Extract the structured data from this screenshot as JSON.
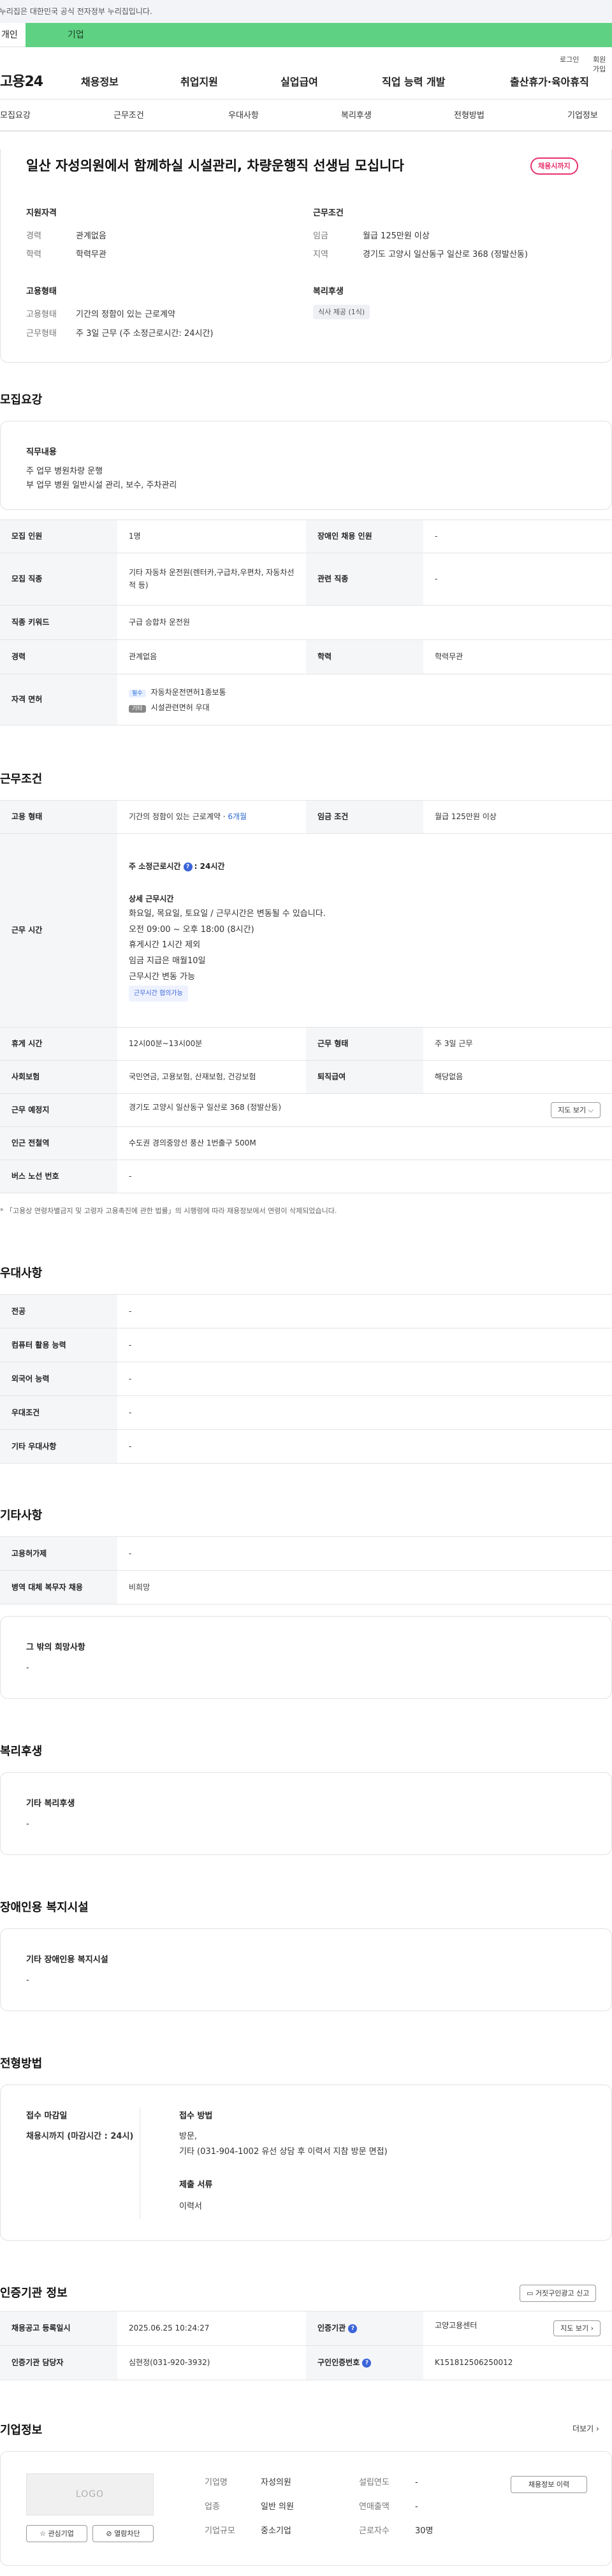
{
  "notice": "이 누리집은 대한민국 공식 전자정부 누리집입니다.",
  "switcher": {
    "personal": "개인",
    "business": "기업"
  },
  "util": {
    "login": "로그인",
    "join": "회원가입"
  },
  "gnb": {
    "logo": "고용24",
    "menus": [
      "채용정보",
      "취업지원",
      "실업급여",
      "직업 능력 개발",
      "출산휴가·육아휴직"
    ]
  },
  "tabs": [
    "모집요강",
    "근무조건",
    "우대사항",
    "복리후생",
    "전형방법",
    "기업정보"
  ],
  "hero": {
    "title": "일산 자성의원에서 함께하실 시설관리, 차량운행직 선생님 모십니다",
    "badge": "채용시까지",
    "qual_title": "지원자격",
    "qual": [
      {
        "k": "경력",
        "v": "관계없음"
      },
      {
        "k": "학력",
        "v": "학력무관"
      }
    ],
    "work_title": "근무조건",
    "work": [
      {
        "k": "임금",
        "v": "월급 125만원 이상"
      },
      {
        "k": "지역",
        "v": "경기도 고양시 일산동구 일산로 368 (정발산동)"
      }
    ],
    "emp_title": "고용형태",
    "emp": [
      {
        "k": "고용형태",
        "v": "기간의 정함이 있는 근로계약"
      },
      {
        "k": "근무형태",
        "v": "주 3일 근무 (주 소정근로시간: 24시간)"
      }
    ],
    "welfare_title": "복리후생",
    "welfare_pill": "식사 제공 (1식)"
  },
  "recruit": {
    "heading": "모집요강",
    "duty_title": "직무내용",
    "duty_lines": [
      "주 업무 병원차량 운행",
      "부 업무 병원 일반시설 관리, 보수, 주차관리"
    ],
    "rows": {
      "count_k": "모집 인원",
      "count_v": "1명",
      "disabled_k": "장애인 채용 인원",
      "disabled_v": "-",
      "job_k": "모집 직종",
      "job_v": "기타 자동차 운전원(렌터카,구급차,우편차, 자동차선적 등)",
      "related_k": "관련 직종",
      "related_v": "-",
      "kw_k": "직종 키워드",
      "kw_v": "구급 승합차 운전원",
      "career_k": "경력",
      "career_v": "관계없음",
      "edu_k": "학력",
      "edu_v": "학력무관",
      "license_k": "자격 면허",
      "license_req_tag": "필수",
      "license_req": "자동차운전면허1종보통",
      "license_opt_tag": "기타",
      "license_opt": "시설관련면허 우대"
    }
  },
  "cond": {
    "heading": "근무조건",
    "type_k": "고용 형태",
    "type_v": "기간의 정함이 있는 근로계약 · ",
    "type_period": "6개월",
    "wage_k": "임금 조건",
    "wage_v": "월급 125만원 이상",
    "time_k": "근무 시간",
    "time_total_prefix": "주 소정근로시간 ",
    "time_total": ": 24시간",
    "time_detail_title": "상세 근무시간",
    "time_lines": [
      "화요일, 목요일, 토요일 / 근무시간은 변동될 수 있습니다.",
      "오전 09:00 ~ 오후 18:00 (8시간)",
      "휴게시간 1시간 제외",
      "임금 지급은 매월10일",
      "근무시간 변동 가능"
    ],
    "time_tag": "근무시간 협의가능",
    "rest_k": "휴게 시간",
    "rest_v": "12시00분~13시00분",
    "form_k": "근무 형태",
    "form_v": "주 3일 근무",
    "ins_k": "사회보험",
    "ins_v": "국민연금, 고용보험, 산재보험, 건강보험",
    "sev_k": "퇴직급여",
    "sev_v": "해당없음",
    "place_k": "근무 예정지",
    "place_v": "경기도 고양시 일산동구 일산로 368 (정발산동)",
    "map_btn": "지도 보기",
    "station_k": "인근 전철역",
    "station_v": "수도권 경의중앙선 풍산 1번출구 500M",
    "bus_k": "버스 노선 번호",
    "bus_v": "-",
    "note": "* 「고용상 연령차별금지 및 고령자 고용촉진에 관한 법률」의 시행령에 따라 채용정보에서 연령이 삭제되었습니다."
  },
  "pref": {
    "heading": "우대사항",
    "rows": [
      {
        "k": "전공",
        "v": "-"
      },
      {
        "k": "컴퓨터 활용 능력",
        "v": "-"
      },
      {
        "k": "외국어 능력",
        "v": "-"
      },
      {
        "k": "우대조건",
        "v": "-"
      },
      {
        "k": "기타 우대사항",
        "v": "-"
      }
    ]
  },
  "etc": {
    "heading": "기타사항",
    "rows": [
      {
        "k": "고용허가제",
        "v": "-"
      },
      {
        "k": "병역 대체 복무자 채용",
        "v": "비희망"
      }
    ],
    "box_title": "그 밖의 희망사항",
    "box_text": "-"
  },
  "welfare": {
    "heading": "복리후생",
    "box_title": "기타 복리후생",
    "box_text": "-"
  },
  "disability": {
    "heading": "장애인용 복지시설",
    "box_title": "기타 장애인용 복지시설",
    "box_text": "-"
  },
  "select": {
    "heading": "전형방법",
    "deadline_title": "접수 마감일",
    "deadline": "채용시까지 (마감시간 : 24시)",
    "method_title": "접수 방법",
    "method_lines": [
      "방문,",
      "기타 (031-904-1002 유선 상담 후 이력서 지참 방문 면접)"
    ],
    "docs_title": "제출 서류",
    "docs": "이력서"
  },
  "agency": {
    "heading": "인증기관 정보",
    "report_btn": "거짓구인광고 신고",
    "reg_k": "채용공고 등록일시",
    "reg_v": "2025.06.25 10:24:27",
    "org_k": "인증기관",
    "org_v": "고양고용센터",
    "mgr_k": "인증기관 담당자",
    "mgr_v": "심현정(031-920-3932)",
    "num_k": "구인인증번호",
    "num_v": "K151812506250012",
    "map_btn": "지도 보기"
  },
  "company": {
    "heading": "기업정보",
    "more": "더보기",
    "logo_text": "LOGO",
    "fav_btn": "관심기업",
    "block_btn": "열람차단",
    "name_k": "기업명",
    "name_v": "자성의원",
    "ind_k": "업종",
    "ind_v": "일반 의원",
    "size_k": "기업규모",
    "size_v": "중소기업",
    "year_k": "설립연도",
    "year_v": "-",
    "sales_k": "연매출액",
    "sales_v": "-",
    "staff_k": "근로자수",
    "staff_v": "30명",
    "jobs_btn": "채용정보 이력"
  }
}
